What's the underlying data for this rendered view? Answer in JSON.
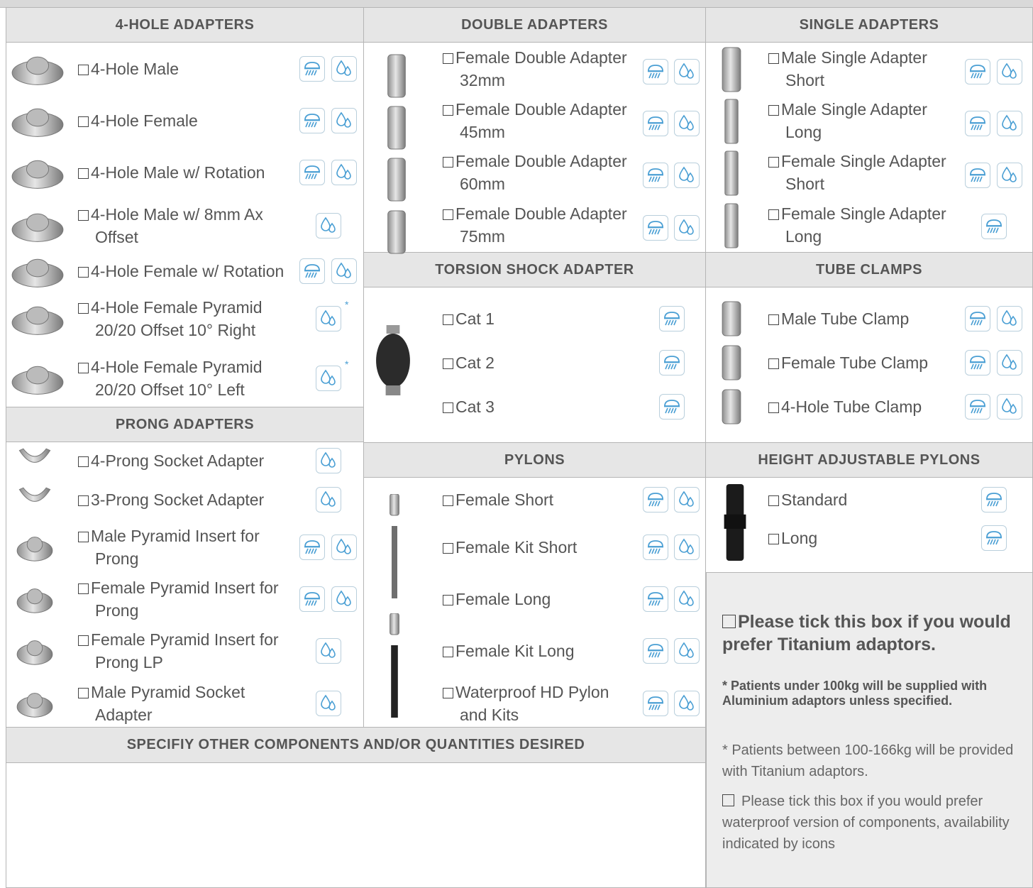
{
  "colors": {
    "header_bg": "#e6e6e6",
    "icon_blue": "#4a9fd4",
    "note_bg": "#ededed"
  },
  "headers": {
    "four_hole": "4-HOLE ADAPTERS",
    "double": "DOUBLE ADAPTERS",
    "single": "SINGLE ADAPTERS",
    "torsion": "TORSION SHOCK ADAPTER",
    "tube_clamps": "TUBE CLAMPS",
    "prong": "PRONG ADAPTERS",
    "pylons": "PYLONS",
    "height_pylons": "HEIGHT ADJUSTABLE PYLONS",
    "other": "SPECIFIY OTHER COMPONENTS AND/OR QUANTITIES DESIRED"
  },
  "four_hole": [
    {
      "l1": "4-Hole Male",
      "l2": ""
    },
    {
      "l1": "4-Hole Female",
      "l2": ""
    },
    {
      "l1": "4-Hole Male w/ Rotation",
      "l2": ""
    },
    {
      "l1": "4-Hole Male w/ 8mm Ax",
      "l2": "Offset"
    },
    {
      "l1": "4-Hole Female w/ Rotation",
      "l2": ""
    },
    {
      "l1": "4-Hole Female Pyramid",
      "l2": "20/20 Offset 10° Right"
    },
    {
      "l1": "4-Hole Female Pyramid",
      "l2": "20/20 Offset 10° Left"
    }
  ],
  "double": [
    {
      "l1": "Female Double Adapter",
      "l2": "32mm"
    },
    {
      "l1": "Female Double Adapter",
      "l2": "45mm"
    },
    {
      "l1": "Female Double Adapter",
      "l2": "60mm"
    },
    {
      "l1": "Female Double Adapter",
      "l2": "75mm"
    }
  ],
  "single": [
    {
      "l1": "Male Single Adapter",
      "l2": "Short"
    },
    {
      "l1": "Male Single Adapter",
      "l2": "Long"
    },
    {
      "l1": "Female Single Adapter",
      "l2": "Short"
    },
    {
      "l1": "Female Single Adapter",
      "l2": "Long"
    }
  ],
  "torsion": [
    {
      "l1": "Cat 1"
    },
    {
      "l1": "Cat 2"
    },
    {
      "l1": "Cat 3"
    }
  ],
  "tube_clamps": [
    {
      "l1": "Male Tube Clamp"
    },
    {
      "l1": "Female Tube Clamp"
    },
    {
      "l1": "4-Hole Tube Clamp"
    }
  ],
  "prong": [
    {
      "l1": "4-Prong Socket Adapter",
      "l2": ""
    },
    {
      "l1": "3-Prong Socket Adapter",
      "l2": ""
    },
    {
      "l1": "Male Pyramid Insert for",
      "l2": "Prong"
    },
    {
      "l1": "Female Pyramid Insert for",
      "l2": "Prong"
    },
    {
      "l1": "Female Pyramid Insert for",
      "l2": "Prong LP"
    },
    {
      "l1": "Male Pyramid Socket",
      "l2": "Adapter"
    }
  ],
  "pylons": [
    {
      "l1": "Female Short",
      "l2": ""
    },
    {
      "l1": "Female Kit Short",
      "l2": ""
    },
    {
      "l1": "Female Long",
      "l2": ""
    },
    {
      "l1": "Female Kit Long",
      "l2": ""
    },
    {
      "l1": "Waterproof HD Pylon",
      "l2": "and Kits"
    }
  ],
  "height_pylons": [
    {
      "l1": "Standard"
    },
    {
      "l1": "Long"
    }
  ],
  "notes": {
    "titanium_check": "Please tick this box if you would prefer Titanium adaptors.",
    "aluminium_note": "* Patients under 100kg will be supplied with Aluminium adaptors unless specified.",
    "weight_note": "* Patients between 100-166kg will be provided with Titanium adaptors.",
    "waterproof_check": "Please tick this box if you would prefer waterproof version of components, availability indicated by icons"
  },
  "icon_names": {
    "rain": "rain-shower-icon",
    "drops": "water-drops-icon"
  }
}
